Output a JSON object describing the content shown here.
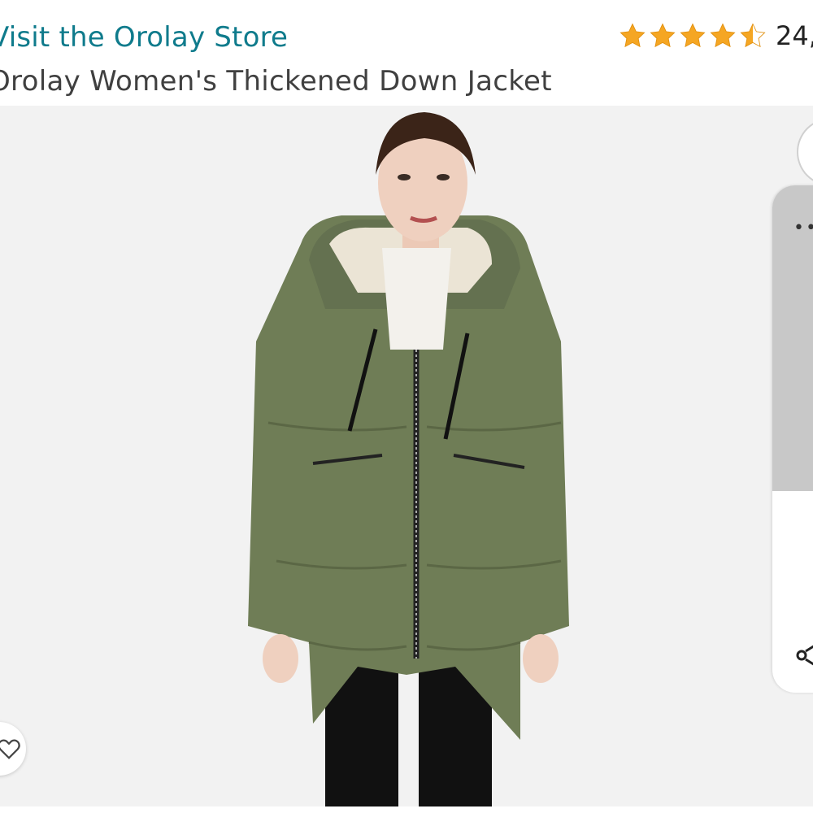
{
  "header": {
    "store_link": "Visit the Orolay Store",
    "product_title": "Orolay Women's Thickened Down Jacket",
    "rating_count": "24,",
    "rating_stars": 4.5
  },
  "image": {
    "description_icon": "product-photo-icon",
    "background_color": "#f2f2f2",
    "jacket_color": "#6f7d56"
  },
  "side_panel": {
    "dots": "••",
    "share_icon": "share-icon"
  },
  "wishlist": {
    "icon": "heart-icon"
  },
  "colors": {
    "link": "#0f7b8c",
    "star": "#f5a623",
    "title": "#404040"
  }
}
